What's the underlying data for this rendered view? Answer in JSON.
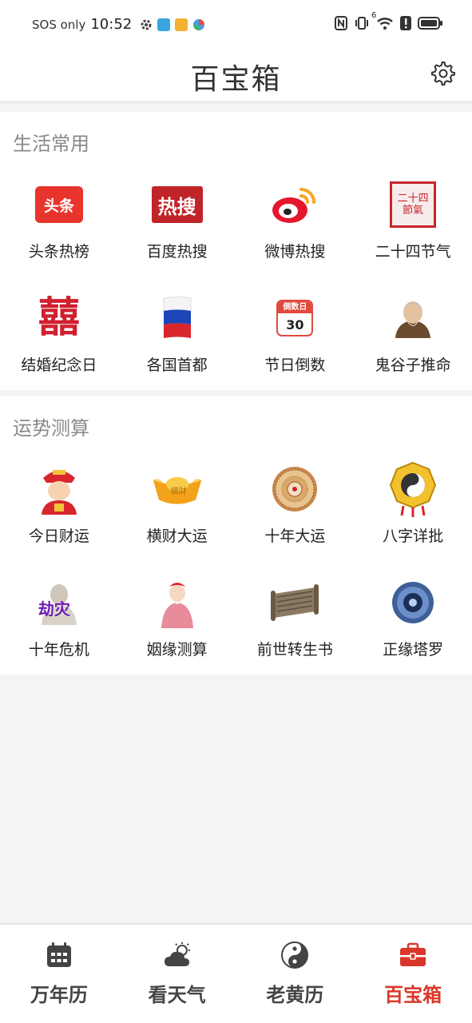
{
  "status_bar": {
    "carrier": "SOS only",
    "time": "10:52",
    "network": "6"
  },
  "header": {
    "title": "百宝箱"
  },
  "sections": [
    {
      "title": "生活常用",
      "items": [
        {
          "label": "头条热榜",
          "icon": "toutiao-logo",
          "icon_text": "头条"
        },
        {
          "label": "百度热搜",
          "icon": "hot-search-logo",
          "icon_text": "热搜"
        },
        {
          "label": "微博热搜",
          "icon": "weibo-logo"
        },
        {
          "label": "二十四节气",
          "icon": "solar-terms-seal",
          "icon_text": "二十四節氣"
        },
        {
          "label": "结婚纪念日",
          "icon": "double-happiness",
          "icon_text": "囍"
        },
        {
          "label": "各国首都",
          "icon": "flag"
        },
        {
          "label": "节日倒数",
          "icon": "countdown-calendar",
          "icon_text": "倒数日",
          "icon_number": "30"
        },
        {
          "label": "鬼谷子推命",
          "icon": "guiguzi-portrait"
        }
      ]
    },
    {
      "title": "运势测算",
      "items": [
        {
          "label": "今日财运",
          "icon": "god-of-wealth"
        },
        {
          "label": "横财大运",
          "icon": "gold-ingot",
          "icon_text": "横财"
        },
        {
          "label": "十年大运",
          "icon": "luopan-compass"
        },
        {
          "label": "八字详批",
          "icon": "bagua-amulet"
        },
        {
          "label": "十年危机",
          "icon": "calamity-buddha",
          "icon_text": "劫灾"
        },
        {
          "label": "姻缘测算",
          "icon": "matchmaker-elder"
        },
        {
          "label": "前世转生书",
          "icon": "scroll"
        },
        {
          "label": "正缘塔罗",
          "icon": "tarot-orb"
        }
      ]
    }
  ],
  "bottom_nav": [
    {
      "label": "万年历",
      "icon": "calendar-icon",
      "active": false
    },
    {
      "label": "看天气",
      "icon": "weather-icon",
      "active": false
    },
    {
      "label": "老黄历",
      "icon": "yin-yang-icon",
      "active": false
    },
    {
      "label": "百宝箱",
      "icon": "toolbox-icon",
      "active": true
    }
  ],
  "colors": {
    "accent": "#d9372a",
    "section_title": "#8a8a8a",
    "background": "#f4f4f4"
  }
}
